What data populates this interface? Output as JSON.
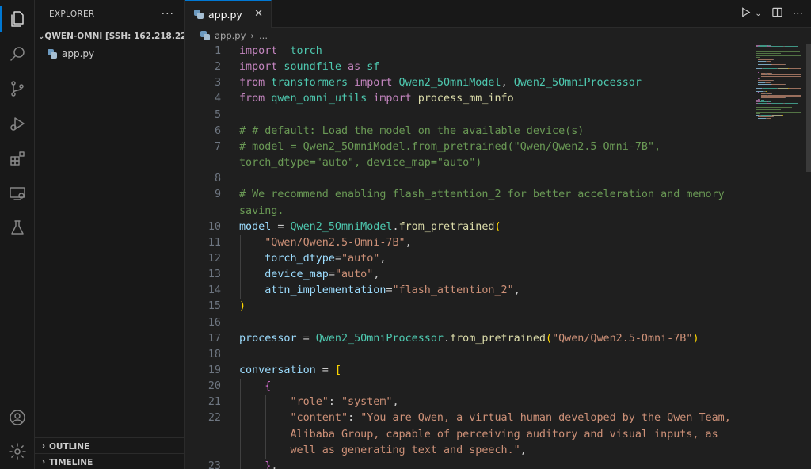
{
  "activity_bar": {
    "items": [
      {
        "name": "explorer-icon"
      },
      {
        "name": "search-icon"
      },
      {
        "name": "source-control-icon"
      },
      {
        "name": "run-debug-icon"
      },
      {
        "name": "extensions-icon"
      },
      {
        "name": "remote-explorer-icon"
      },
      {
        "name": "testing-icon"
      },
      {
        "name": "account-icon"
      },
      {
        "name": "settings-gear-icon"
      }
    ]
  },
  "sidebar": {
    "title": "EXPLORER",
    "more": "···",
    "folder": "QWEN-OMNI [SSH: 162.218.22...",
    "files": [
      "app.py"
    ],
    "outline": "OUTLINE",
    "timeline": "TIMELINE"
  },
  "tab": {
    "label": "app.py",
    "close": "✕"
  },
  "breadcrumb": {
    "file": "app.py",
    "sep": "›",
    "more": "..."
  },
  "editor": {
    "line_numbers": [
      "1",
      "2",
      "3",
      "4",
      "5",
      "6",
      "7",
      "8",
      "9",
      "10",
      "11",
      "12",
      "13",
      "14",
      "15",
      "16",
      "17",
      "18",
      "19",
      "20",
      "21",
      "22",
      "23"
    ],
    "lines": [
      [
        [
          "kw",
          "import"
        ],
        [
          "",
          "  "
        ],
        [
          "mod",
          "torch"
        ]
      ],
      [
        [
          "kw",
          "import"
        ],
        [
          "",
          ""
        ],
        [
          "mod",
          " soundfile"
        ],
        [
          "kw",
          " as"
        ],
        [
          "mod",
          " sf"
        ]
      ],
      [
        [
          "kw",
          "from"
        ],
        [
          "mod",
          " transformers"
        ],
        [
          "kw",
          " import"
        ],
        [
          "cls",
          " Qwen2_5OmniModel"
        ],
        [
          "",
          ", "
        ],
        [
          "cls",
          "Qwen2_5OmniProcessor"
        ]
      ],
      [
        [
          "kw",
          "from"
        ],
        [
          "mod",
          " qwen_omni_utils"
        ],
        [
          "kw",
          " import"
        ],
        [
          "fn",
          " process_mm_info"
        ]
      ],
      [],
      [
        [
          "cmt",
          "# # default: Load the model on the available device(s)"
        ]
      ],
      [
        [
          "cmt",
          "# model = Qwen2_5OmniModel.from_pretrained(\"Qwen/Qwen2.5-Omni-7B\","
        ]
      ],
      [
        [
          "cmt",
          "torch_dtype=\"auto\", device_map=\"auto\")"
        ]
      ],
      [],
      [
        [
          "cmt",
          "# We recommend enabling flash_attention_2 for better acceleration and memory"
        ]
      ],
      [
        [
          "cmt",
          "saving."
        ]
      ],
      [
        [
          "var",
          "model"
        ],
        [
          "",
          " = "
        ],
        [
          "cls",
          "Qwen2_5OmniModel"
        ],
        [
          "",
          "."
        ],
        [
          "fn",
          "from_pretrained"
        ],
        [
          "br1",
          "("
        ]
      ],
      [
        [
          "",
          "    "
        ],
        [
          "str",
          "\"Qwen/Qwen2.5-Omni-7B\""
        ],
        [
          "",
          ","
        ]
      ],
      [
        [
          "",
          "    "
        ],
        [
          "var",
          "torch_dtype"
        ],
        [
          "",
          "="
        ],
        [
          "str",
          "\"auto\""
        ],
        [
          "",
          ","
        ]
      ],
      [
        [
          "",
          "    "
        ],
        [
          "var",
          "device_map"
        ],
        [
          "",
          "="
        ],
        [
          "str",
          "\"auto\""
        ],
        [
          "",
          ","
        ]
      ],
      [
        [
          "",
          "    "
        ],
        [
          "var",
          "attn_implementation"
        ],
        [
          "",
          "="
        ],
        [
          "str",
          "\"flash_attention_2\""
        ],
        [
          "",
          ","
        ]
      ],
      [
        [
          "br1",
          ")"
        ]
      ],
      [],
      [
        [
          "var",
          "processor"
        ],
        [
          "",
          " = "
        ],
        [
          "cls",
          "Qwen2_5OmniProcessor"
        ],
        [
          "",
          "."
        ],
        [
          "fn",
          "from_pretrained"
        ],
        [
          "br1",
          "("
        ],
        [
          "str",
          "\"Qwen/Qwen2.5-Omni-7B\""
        ],
        [
          "br1",
          ")"
        ]
      ],
      [],
      [
        [
          "var",
          "conversation"
        ],
        [
          "",
          " = "
        ],
        [
          "br1",
          "["
        ]
      ],
      [
        [
          "",
          "    "
        ],
        [
          "br2",
          "{"
        ]
      ],
      [
        [
          "",
          "        "
        ],
        [
          "str",
          "\"role\""
        ],
        [
          "",
          ": "
        ],
        [
          "str",
          "\"system\""
        ],
        [
          "",
          ","
        ]
      ],
      [
        [
          "",
          "        "
        ],
        [
          "str",
          "\"content\""
        ],
        [
          "",
          ": "
        ],
        [
          "str",
          "\"You are Qwen, a virtual human developed by the Qwen Team,"
        ]
      ],
      [
        [
          "",
          "        "
        ],
        [
          "str",
          "Alibaba Group, capable of perceiving auditory and visual inputs, as"
        ]
      ],
      [
        [
          "",
          "        "
        ],
        [
          "str",
          "well as generating text and speech.\""
        ],
        [
          "",
          ","
        ]
      ],
      [
        [
          "",
          "    "
        ],
        [
          "br2",
          "}"
        ],
        [
          "",
          ","
        ]
      ]
    ]
  }
}
